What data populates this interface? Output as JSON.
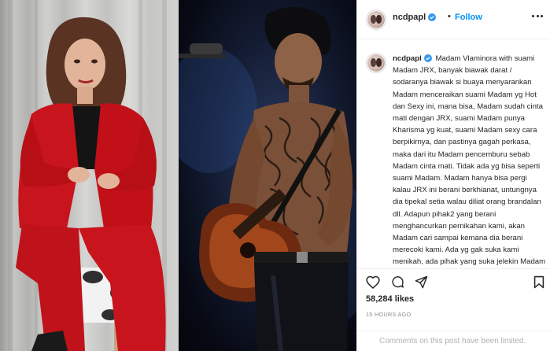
{
  "post": {
    "username": "ncdpapl",
    "dot": "•",
    "follow_label": "Follow",
    "verified": true
  },
  "caption": {
    "username": "ncdpapl",
    "text": "Madam Vlaminora with suami Madam JRX, banyak biawak darat / sodaranya biawak si buaya menyarankan Madam menceraikan suami Madam yg Hot dan Sexy ini, mana bisa, Madam sudah cinta mati dengan JRX, suami Madam punya Kharisma yg kuat, suami Madam sexy cara berpikirnya, dan pastinya gagah perkasa, maka dari itu Madam pencemburu sebab Madam cinta mati. Tidak ada yg bisa seperti suami Madam. Madam hanya bisa pergi kalau JRX ini berani berkhianat, untungnya dia tipekal setia walau diliat orang brandalan dll. Adapun pihak2 yang berani menghancurkan pernikahan kami, akan Madam cari sampai kemana dia berani merecoki kami. Ada yg gak suka kami menikah, ada pihak yang suka jelekin Madam"
  },
  "engagement": {
    "likes": "58,284 likes",
    "timestamp": "15 HOURS AGO",
    "comments_notice": "Comments on this post have been limited."
  },
  "icons": {
    "like": "heart-icon",
    "comment": "comment-icon",
    "share": "share-icon",
    "save": "bookmark-icon",
    "more": "more-options-icon",
    "verified": "verified-badge-icon"
  },
  "colors": {
    "accent": "#0095f6",
    "verified": "#3897f0",
    "text": "#262626",
    "muted": "#8e8e8e",
    "border": "#efefef",
    "left_photo_outfit": "#c8141c"
  }
}
